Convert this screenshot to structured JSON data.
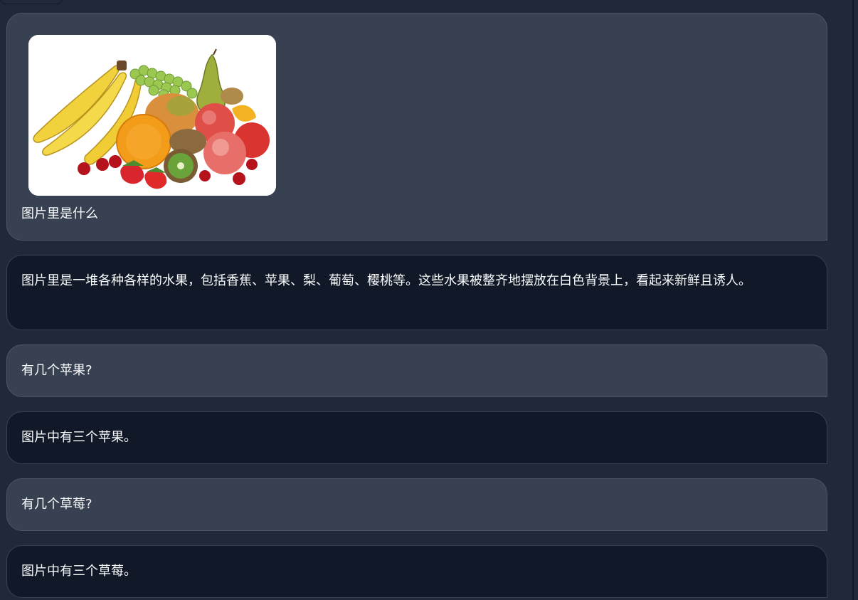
{
  "chat": {
    "messages": [
      {
        "role": "user",
        "text": "图片里是什么",
        "image_icon": "fruit-photo"
      },
      {
        "role": "assistant",
        "text": "图片里是一堆各种各样的水果，包括香蕉、苹果、梨、葡萄、樱桃等。这些水果被整齐地摆放在白色背景上，看起来新鲜且诱人。"
      },
      {
        "role": "user",
        "text": "有几个苹果?"
      },
      {
        "role": "assistant",
        "text": "图片中有三个苹果。"
      },
      {
        "role": "user",
        "text": "有几个草莓?"
      },
      {
        "role": "assistant",
        "text": "图片中有三个草莓。"
      }
    ]
  },
  "colors": {
    "background": "#1f2937",
    "user_bubble": "#374151",
    "assistant_bubble": "#111827",
    "text": "#f9fafb"
  }
}
